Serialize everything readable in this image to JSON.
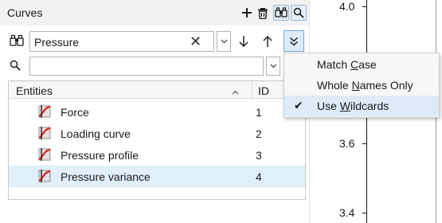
{
  "panel": {
    "title": "Curves",
    "header_icons": [
      "add-icon",
      "delete-icon",
      "binoculars-icon",
      "find-icon"
    ]
  },
  "search": {
    "value": "Pressure",
    "clear_glyph": "✕",
    "options_icon": "double-chevron-down-icon"
  },
  "filter": {
    "value": "",
    "placeholder": ""
  },
  "table": {
    "columns": {
      "entities": "Entities",
      "id": "ID"
    },
    "rows": [
      {
        "name": "Force",
        "id": "1"
      },
      {
        "name": "Loading curve",
        "id": "2"
      },
      {
        "name": "Pressure profile",
        "id": "3"
      },
      {
        "name": "Pressure variance",
        "id": "4"
      }
    ]
  },
  "menu": {
    "items": [
      {
        "pre": "Match ",
        "acc": "C",
        "post": "ase",
        "checked": false
      },
      {
        "pre": "Whole ",
        "acc": "N",
        "post": "ames Only",
        "checked": false
      },
      {
        "pre": "Use ",
        "acc": "W",
        "post": "ildcards",
        "checked": true
      }
    ],
    "check_glyph": "✔"
  },
  "plot": {
    "tick_labels": [
      "4.0",
      "3.6",
      "3.4"
    ]
  },
  "colors": {
    "accent": "#dcebf7",
    "selected_row": "#e0f0fb",
    "curve_icon_red": "#d7261e"
  }
}
